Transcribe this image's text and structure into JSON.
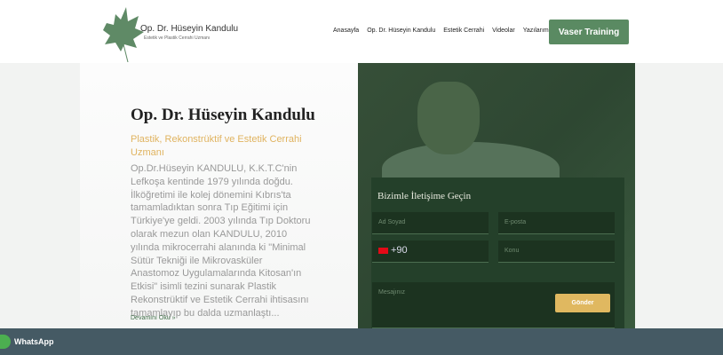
{
  "header": {
    "brand_name": "Op. Dr. Hüseyin Kandulu",
    "brand_sub": "Estetik ve Plastik Cerrahi Uzmanı",
    "nav": [
      "Anasayfa",
      "Op. Dr. Hüseyin Kandulu",
      "Estetik Cerrahi",
      "Videolar",
      "Yazılarım"
    ],
    "cta": "Vaser Training",
    "accent": "#5a8a62"
  },
  "about": {
    "title": "Op. Dr. Hüseyin Kandulu",
    "subtitle": "Plastik, Rekonstrüktif ve Estetik Cerrahi Uzmanı",
    "paragraph_lines": [
      "Op.Dr.Hüseyin KANDULU, K.K.T.C'nin",
      "Lefkoşa kentinde 1979 yılında doğdu.",
      "İlköğretimi ile kolej dönemini Kıbrıs'ta",
      "tamamladıktan sonra Tıp Eğitimi için",
      "Türkiye'ye geldi. 2003 yılında Tıp Doktoru",
      "olarak mezun olan KANDULU, 2010",
      "yılında mikrocerrahi alanında ki \"Minimal",
      "Sütür Tekniği ile Mikrovasküler",
      "Anastomoz Uygulamalarında Kitosan'ın",
      "Etkisi\" isimli tezini sunarak Plastik",
      "Rekonstrüktif ve Estetik Cerrahi ihtisasını",
      "tamamlayıp bu dalda uzmanlaştı..."
    ],
    "read_more": "Devamını Oku »"
  },
  "contact": {
    "title": "Bizimle İletişime Geçin",
    "name_placeholder": "Ad Soyad",
    "email_placeholder": "E-posta",
    "phone_code": "+90",
    "subject_placeholder": "Konu",
    "message_placeholder": "Mesajınız",
    "submit": "Gönder"
  },
  "whatsapp": {
    "label": "WhatsApp"
  }
}
